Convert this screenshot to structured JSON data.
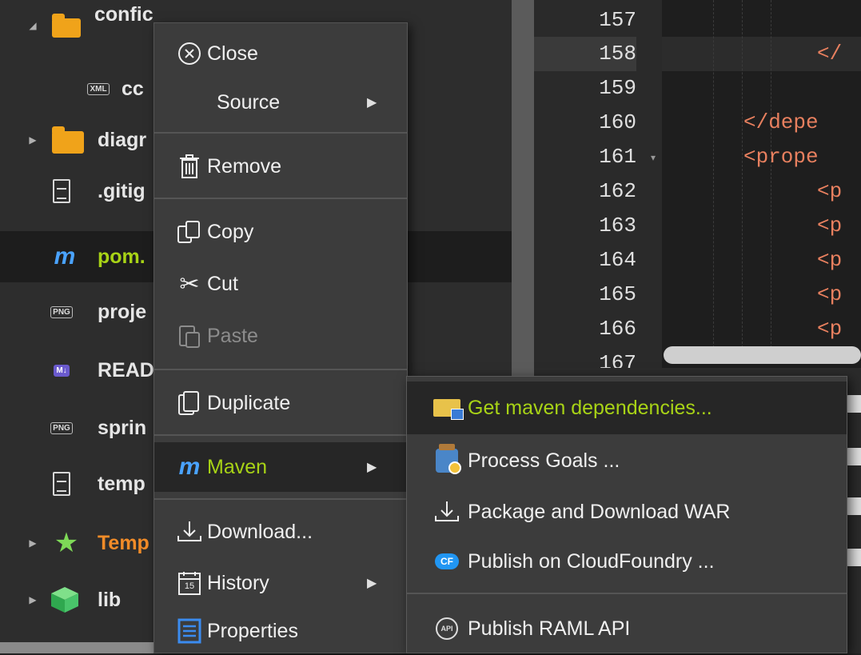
{
  "tree": {
    "items": [
      {
        "label": "confic",
        "icon": "config-folder-icon",
        "expanded": true
      },
      {
        "label": "cc",
        "icon": "xml-file-icon"
      },
      {
        "label": "diagr",
        "icon": "folder-icon",
        "expanded": false
      },
      {
        "label": ".gitig",
        "icon": "text-file-icon"
      },
      {
        "label": "pom.",
        "icon": "maven-icon",
        "selected": true
      },
      {
        "label": "proje",
        "icon": "png-file-icon",
        "badge": "PNG"
      },
      {
        "label": "READ",
        "icon": "markdown-file-icon",
        "badge": "M↓"
      },
      {
        "label": "sprin",
        "icon": "png-file-icon",
        "badge": "PNG"
      },
      {
        "label": "temp",
        "icon": "text-file-icon"
      },
      {
        "label": "Temp",
        "icon": "star-icon",
        "expanded": false
      },
      {
        "label": "lib",
        "icon": "package-icon",
        "expanded": false
      }
    ],
    "xml_badge": "XML",
    "maven_glyph": "m"
  },
  "editor": {
    "line_numbers": [
      "157",
      "158",
      "159",
      "160",
      "161",
      "162",
      "163",
      "164",
      "165",
      "166",
      "167"
    ],
    "code_lines": [
      {
        "line": "158",
        "text": "</"
      },
      {
        "line": "160",
        "text": "</depe"
      },
      {
        "line": "161",
        "text": "<prope"
      },
      {
        "line": "162",
        "text": "<p"
      },
      {
        "line": "163",
        "text": "<p"
      },
      {
        "line": "164",
        "text": "<p"
      },
      {
        "line": "165",
        "text": "<p"
      },
      {
        "line": "166",
        "text": "<p"
      }
    ],
    "active_line": "158"
  },
  "context_menu": {
    "items": [
      {
        "label": "Close",
        "icon": "close-circle-icon"
      },
      {
        "label": "Source",
        "has_submenu": true
      },
      {
        "label": "Remove",
        "icon": "trash-icon"
      },
      {
        "label": "Copy",
        "icon": "copy-icon"
      },
      {
        "label": "Cut",
        "icon": "scissors-icon"
      },
      {
        "label": "Paste",
        "icon": "paste-icon",
        "disabled": true
      },
      {
        "label": "Duplicate",
        "icon": "duplicate-icon"
      },
      {
        "label": "Maven",
        "icon": "maven-icon",
        "has_submenu": true,
        "highlighted": true
      },
      {
        "label": "Download...",
        "icon": "download-icon"
      },
      {
        "label": "History",
        "icon": "calendar-icon",
        "has_submenu": true,
        "calendar_day": "15"
      },
      {
        "label": "Properties",
        "icon": "properties-icon"
      }
    ]
  },
  "maven_submenu": {
    "items": [
      {
        "label": "Get maven dependencies...",
        "icon": "maven-dependencies-icon",
        "highlighted": true
      },
      {
        "label": "Process Goals ...",
        "icon": "process-goals-icon"
      },
      {
        "label": "Package and Download WAR",
        "icon": "download-icon"
      },
      {
        "label": "Publish on CloudFoundry ...",
        "icon": "cloudfoundry-icon",
        "badge": "CF"
      },
      {
        "label": "Publish RAML API",
        "icon": "api-icon",
        "badge": "API"
      }
    ]
  },
  "colors": {
    "maven_accent": "#a8d316",
    "maven_blue": "#4aa3ff",
    "folder": "#f0a31a",
    "temp_orange": "#f28c28",
    "xml_tag": "#e8805f"
  }
}
